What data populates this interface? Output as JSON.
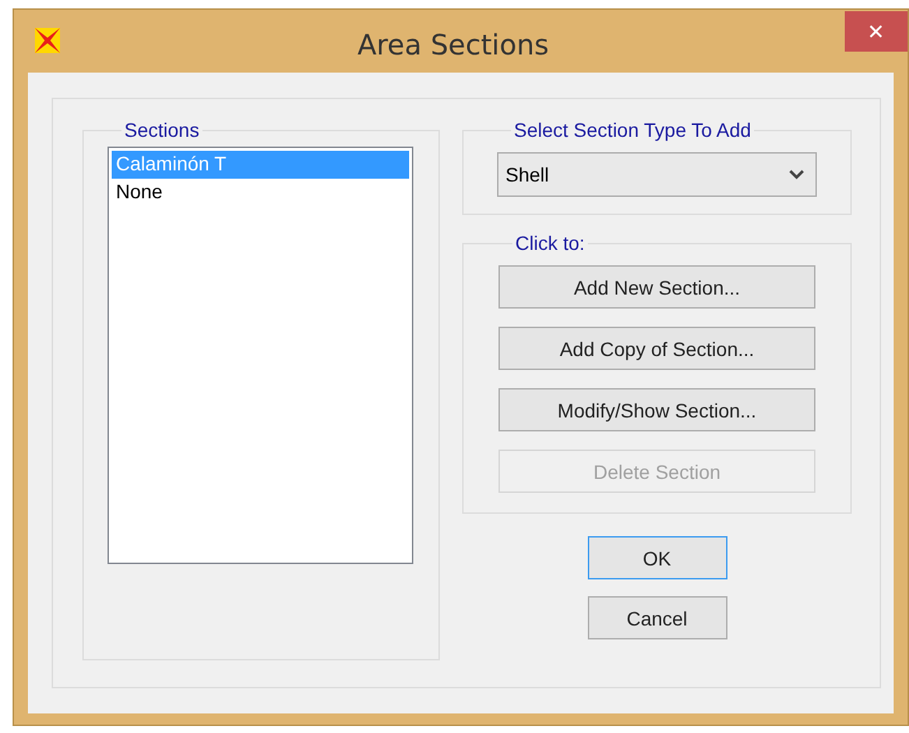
{
  "window": {
    "title": "Area Sections",
    "close": "✕"
  },
  "sections": {
    "label": "Sections",
    "items": [
      {
        "text": "Calaminón T",
        "selected": true
      },
      {
        "text": "None",
        "selected": false
      }
    ]
  },
  "section_type": {
    "label": "Select Section Type To Add",
    "value": "Shell"
  },
  "actions": {
    "label": "Click to:",
    "buttons": [
      {
        "label": "Add New Section...",
        "disabled": false
      },
      {
        "label": "Add Copy of Section...",
        "disabled": false
      },
      {
        "label": "Modify/Show Section...",
        "disabled": false
      },
      {
        "label": "Delete Section",
        "disabled": true
      }
    ]
  },
  "dialog_buttons": [
    {
      "label": "OK",
      "default": true
    },
    {
      "label": "Cancel",
      "default": false
    }
  ]
}
